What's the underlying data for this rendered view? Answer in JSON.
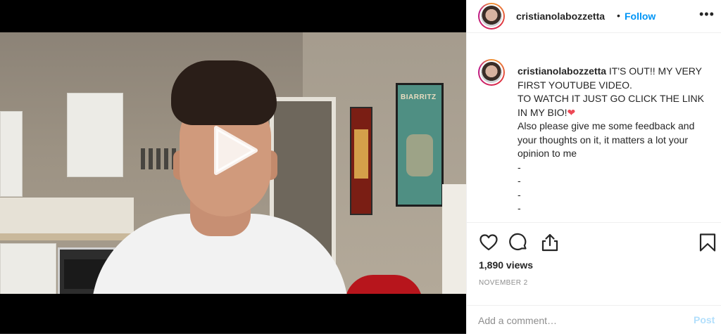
{
  "post": {
    "username": "cristianolabozzetta",
    "follow_label": "Follow",
    "separator": "•",
    "more_label": "•••"
  },
  "video": {
    "poster_text": "BIARRITZ"
  },
  "caption": {
    "username": "cristianolabozzetta",
    "line1": "IT'S OUT!! MY VERY FIRST YOUTUBE VIDEO.",
    "line2": "TO WATCH IT JUST GO CLICK THE LINK IN MY BIO!",
    "heart": "❤",
    "line3": "Also please give me some feedback and your thoughts on it, it matters a lot your opinion to me",
    "dash1": "-",
    "dash2": "-",
    "dash3": "-",
    "dash4": "-"
  },
  "stats": {
    "views": "1,890 views",
    "date": "NOVEMBER 2"
  },
  "comment": {
    "placeholder": "Add a comment…",
    "post_label": "Post"
  },
  "icons": [
    "heart-icon",
    "comment-icon",
    "share-icon",
    "bookmark-icon",
    "play-icon",
    "more-icon"
  ],
  "colors": {
    "link": "#0095f6",
    "post_disabled": "#b2dffc",
    "muted": "#8e8e8e",
    "text": "#262626"
  }
}
